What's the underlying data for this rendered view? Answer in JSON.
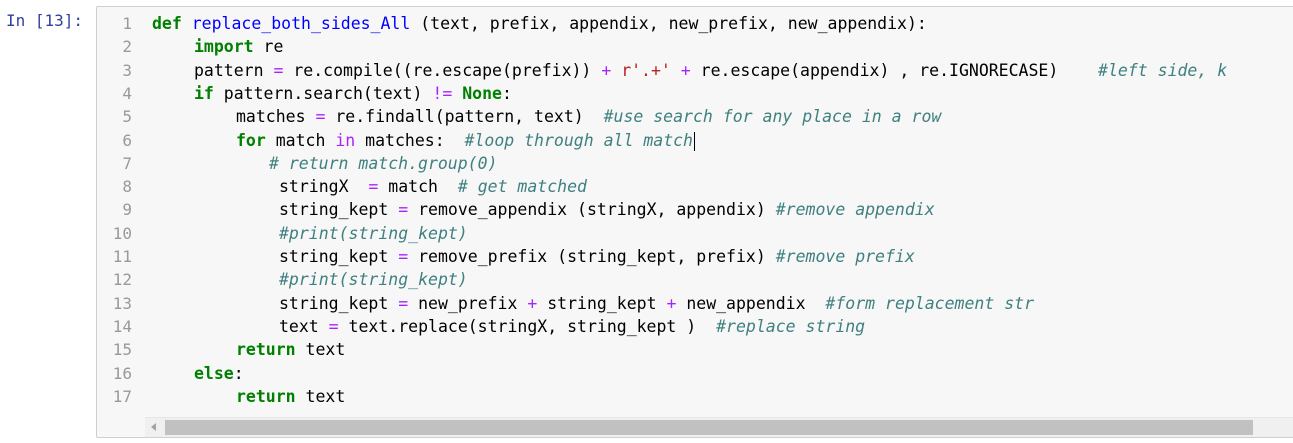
{
  "cell": {
    "prompt": "In [13]:",
    "lines": [
      {
        "n": "1",
        "indent": 0,
        "tokens": [
          [
            "k",
            "def"
          ],
          [
            "t",
            " "
          ],
          [
            "d",
            "replace_both_sides_All"
          ],
          [
            "t",
            " (text, prefix, appendix, new_prefix, new_appendix):"
          ]
        ]
      },
      {
        "n": "2",
        "indent": 1,
        "tokens": [
          [
            "k",
            "import"
          ],
          [
            "t",
            " re"
          ]
        ]
      },
      {
        "n": "3",
        "indent": 1,
        "tokens": [
          [
            "t",
            "pattern "
          ],
          [
            "o",
            "="
          ],
          [
            "t",
            " re.compile((re.escape(prefix)) "
          ],
          [
            "o",
            "+"
          ],
          [
            "t",
            " "
          ],
          [
            "s",
            "r'.+'"
          ],
          [
            "t",
            " "
          ],
          [
            "o",
            "+"
          ],
          [
            "t",
            " re.escape(appendix) , re.IGNORECASE)    "
          ],
          [
            "c",
            "#left side, k"
          ]
        ]
      },
      {
        "n": "4",
        "indent": 1,
        "tokens": [
          [
            "k",
            "if"
          ],
          [
            "t",
            " pattern.search(text) "
          ],
          [
            "o",
            "!="
          ],
          [
            "t",
            " "
          ],
          [
            "k",
            "None"
          ],
          [
            "t",
            ":"
          ]
        ]
      },
      {
        "n": "5",
        "indent": 2,
        "tokens": [
          [
            "t",
            "matches "
          ],
          [
            "o",
            "="
          ],
          [
            "t",
            " re.findall(pattern, text)  "
          ],
          [
            "c",
            "#use search for any place in a row"
          ]
        ]
      },
      {
        "n": "6",
        "indent": 2,
        "tokens": [
          [
            "k",
            "for"
          ],
          [
            "t",
            " match "
          ],
          [
            "o",
            "in"
          ],
          [
            "t",
            " matches:  "
          ],
          [
            "c",
            "#loop through all match"
          ]
        ],
        "caret": true
      },
      {
        "n": "7",
        "indent": 3,
        "tokens": [
          [
            "c",
            "# return match.group(0)"
          ]
        ]
      },
      {
        "n": "8",
        "indent": 4,
        "tokens": [
          [
            "t",
            "stringX  "
          ],
          [
            "o",
            "="
          ],
          [
            "t",
            " match  "
          ],
          [
            "c",
            "# get matched"
          ]
        ]
      },
      {
        "n": "9",
        "indent": 4,
        "tokens": [
          [
            "t",
            "string_kept "
          ],
          [
            "o",
            "="
          ],
          [
            "t",
            " remove_appendix (stringX, appendix) "
          ],
          [
            "c",
            "#remove appendix"
          ]
        ]
      },
      {
        "n": "10",
        "indent": 4,
        "tokens": [
          [
            "c",
            "#print(string_kept)"
          ]
        ]
      },
      {
        "n": "11",
        "indent": 4,
        "tokens": [
          [
            "t",
            "string_kept "
          ],
          [
            "o",
            "="
          ],
          [
            "t",
            " remove_prefix (string_kept, prefix) "
          ],
          [
            "c",
            "#remove prefix"
          ]
        ]
      },
      {
        "n": "12",
        "indent": 4,
        "tokens": [
          [
            "c",
            "#print(string_kept)"
          ]
        ]
      },
      {
        "n": "13",
        "indent": 4,
        "tokens": [
          [
            "t",
            "string_kept "
          ],
          [
            "o",
            "="
          ],
          [
            "t",
            " new_prefix "
          ],
          [
            "o",
            "+"
          ],
          [
            "t",
            " string_kept "
          ],
          [
            "o",
            "+"
          ],
          [
            "t",
            " new_appendix  "
          ],
          [
            "c",
            "#form replacement str"
          ]
        ]
      },
      {
        "n": "14",
        "indent": 4,
        "tokens": [
          [
            "t",
            "text "
          ],
          [
            "o",
            "="
          ],
          [
            "t",
            " text.replace(stringX, string_kept )  "
          ],
          [
            "c",
            "#replace string"
          ]
        ]
      },
      {
        "n": "15",
        "indent": 2,
        "tokens": [
          [
            "k",
            "return"
          ],
          [
            "t",
            " text"
          ]
        ]
      },
      {
        "n": "16",
        "indent": 1,
        "tokens": [
          [
            "k",
            "else"
          ],
          [
            "t",
            ":"
          ]
        ]
      },
      {
        "n": "17",
        "indent": 2,
        "tokens": [
          [
            "k",
            "return"
          ],
          [
            "t",
            " text"
          ]
        ]
      }
    ]
  },
  "colors": {
    "keyword": "#008000",
    "def_name": "#0000ff",
    "operator": "#aa22ff",
    "string": "#ba2121",
    "comment": "#408080",
    "prompt": "#303f9f",
    "line_number": "#999999"
  },
  "icons": {
    "scroll_left": "scroll-left-arrow-icon"
  }
}
